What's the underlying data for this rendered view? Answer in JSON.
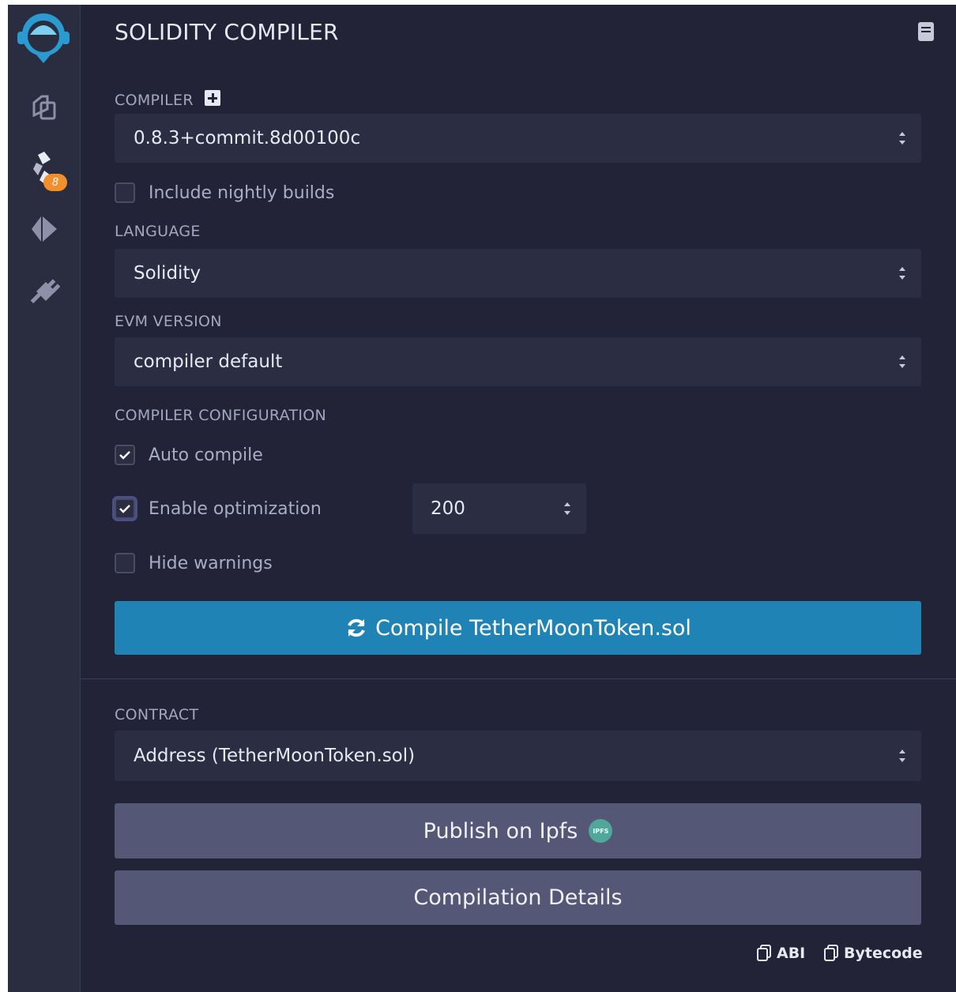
{
  "sidebar": {
    "icons": [
      "remix-logo-icon",
      "file-explorer-icon",
      "solidity-compiler-icon",
      "deploy-run-icon",
      "plugin-manager-icon"
    ],
    "compiler_badge": "8",
    "badge_color": "#f28e2b"
  },
  "header": {
    "title": "SOLIDITY COMPILER"
  },
  "compiler": {
    "label": "COMPILER",
    "value": "0.8.3+commit.8d00100c"
  },
  "nightly": {
    "label": "Include nightly builds",
    "checked": false
  },
  "language": {
    "label": "LANGUAGE",
    "value": "Solidity"
  },
  "evm": {
    "label": "EVM VERSION",
    "value": "compiler default"
  },
  "config": {
    "label": "COMPILER CONFIGURATION",
    "auto_compile": {
      "label": "Auto compile",
      "checked": true
    },
    "optimization": {
      "label": "Enable optimization",
      "checked": true,
      "runs": "200"
    },
    "hide_warnings": {
      "label": "Hide warnings",
      "checked": false
    }
  },
  "compile_button": {
    "label": "Compile TetherMoonToken.sol",
    "color": "#1f84b5"
  },
  "contract": {
    "label": "CONTRACT",
    "value": "Address (TetherMoonToken.sol)"
  },
  "publish_button": {
    "label": "Publish on Ipfs",
    "icon_text": "IPFS"
  },
  "details_button": {
    "label": "Compilation Details"
  },
  "copy_links": {
    "abi": "ABI",
    "bytecode": "Bytecode"
  }
}
